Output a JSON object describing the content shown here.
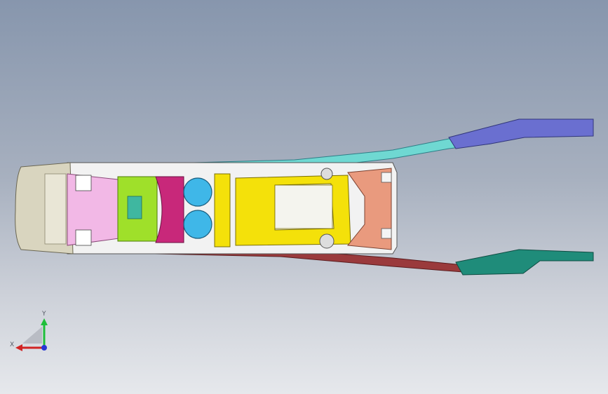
{
  "view": {
    "colors": {
      "bg_top": "#8796ad",
      "bg_bottom": "#e6e8ec",
      "endcap": "#d9d5bf",
      "armrest_pink": "#f2b8e6",
      "green_block": "#9fe02a",
      "magenta_block": "#c8287a",
      "cupholder_blue": "#3fb7e8",
      "yellow_frame": "#f4e10a",
      "salmon_bracket": "#e99a7e",
      "rail_top": "#6fd8d2",
      "rail_bottom": "#9a3a3c",
      "tail_top": "#6a6fd0",
      "tail_bottom": "#1f8c7a"
    }
  },
  "triad": {
    "x_label": "X",
    "y_label": "Y",
    "x_icon": "x-axis-arrow-icon",
    "y_icon": "y-axis-arrow-icon",
    "z_icon": "z-axis-dot-icon"
  }
}
